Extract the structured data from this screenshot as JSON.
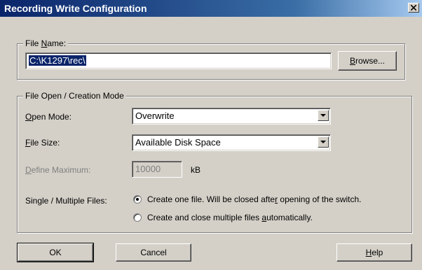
{
  "window": {
    "title": "Recording Write Configuration",
    "close_glyph": "✕"
  },
  "file_name_group": {
    "title_pre": "File ",
    "title_accel": "N",
    "title_post": "ame:",
    "path_value": "C:\\K1297\\rec\\",
    "browse_accel": "B",
    "browse_rest": "rowse..."
  },
  "mode_group": {
    "title": "File Open / Creation Mode",
    "open_mode_accel": "O",
    "open_mode_rest": "pen Mode:",
    "open_mode_value": "Overwrite",
    "file_size_accel": "F",
    "file_size_rest": "ile Size:",
    "file_size_value": "Available Disk Space",
    "define_max_accel": "D",
    "define_max_rest": "efine Maximum:",
    "define_max_value": "10000",
    "define_max_unit": "kB",
    "single_multiple_label": "Single / Multiple Files:",
    "radio_one_pre": "Create one file. Will be closed afte",
    "radio_one_accel": "r",
    "radio_one_post": " opening of the switch.",
    "radio_one_selected": true,
    "radio_multi_pre": "Create and close multiple files ",
    "radio_multi_accel": "a",
    "radio_multi_post": "utomatically.",
    "radio_multi_selected": false
  },
  "buttons": {
    "ok": "OK",
    "cancel": "Cancel",
    "help_accel": "H",
    "help_rest": "elp"
  },
  "icons": {
    "dropdown": "dropdown-arrow-icon",
    "close": "close-icon"
  },
  "colors": {
    "titlebar_start": "#0a246a",
    "titlebar_end": "#a6caf0",
    "face": "#d4d0c8",
    "selection": "#0a246a"
  }
}
